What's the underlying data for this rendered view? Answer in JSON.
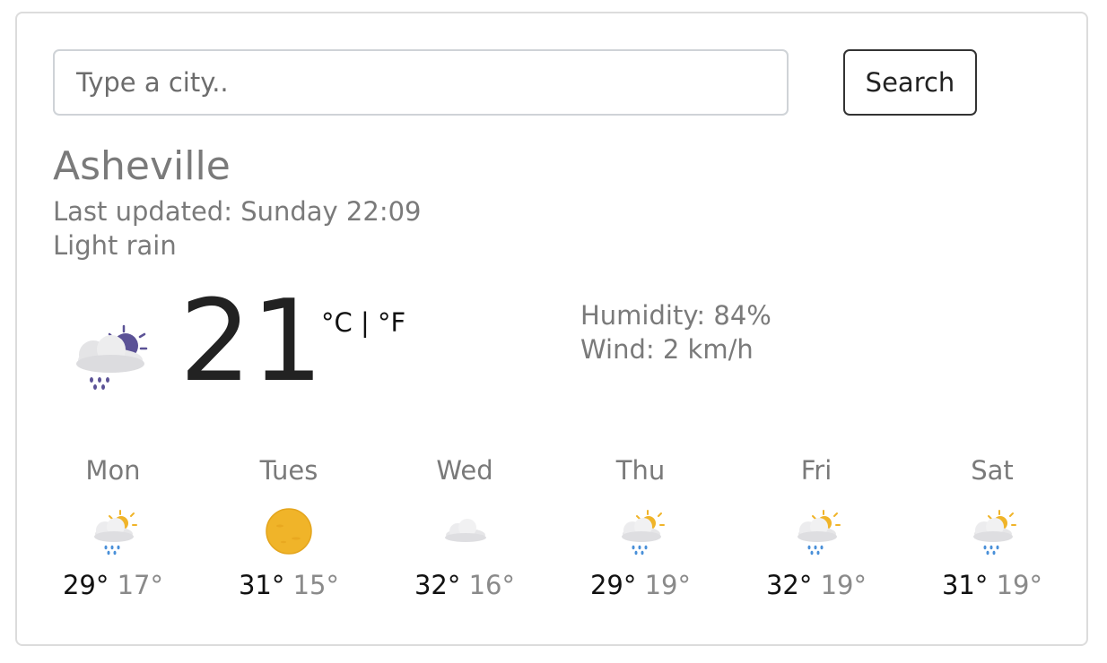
{
  "search": {
    "placeholder": "Type a city..",
    "value": "",
    "button_label": "Search"
  },
  "current": {
    "city": "Asheville",
    "last_updated": "Last updated: Sunday 22:09",
    "description": "Light rain",
    "temperature": "21",
    "unit_celsius": "°C",
    "unit_separator": " | ",
    "unit_fahrenheit": "°F",
    "humidity": "Humidity: 84%",
    "wind": "Wind: 2 km/h",
    "icon": "night-rain-icon"
  },
  "forecast": [
    {
      "day": "Mon",
      "max": "29°",
      "min": "17°",
      "icon": "partly-cloudy-rain-icon"
    },
    {
      "day": "Tues",
      "max": "31°",
      "min": "15°",
      "icon": "sun-icon"
    },
    {
      "day": "Wed",
      "max": "32°",
      "min": "16°",
      "icon": "cloud-icon"
    },
    {
      "day": "Thu",
      "max": "29°",
      "min": "19°",
      "icon": "partly-cloudy-rain-icon"
    },
    {
      "day": "Fri",
      "max": "32°",
      "min": "19°",
      "icon": "partly-cloudy-rain-icon"
    },
    {
      "day": "Sat",
      "max": "31°",
      "min": "19°",
      "icon": "partly-cloudy-rain-icon"
    }
  ],
  "colors": {
    "muted_text": "#7a7a7a",
    "primary_text": "#222222",
    "border": "#dcdcdc",
    "sun": "#f0b429",
    "moon": "#5b5296",
    "rain_drop": "#4a90d9"
  }
}
